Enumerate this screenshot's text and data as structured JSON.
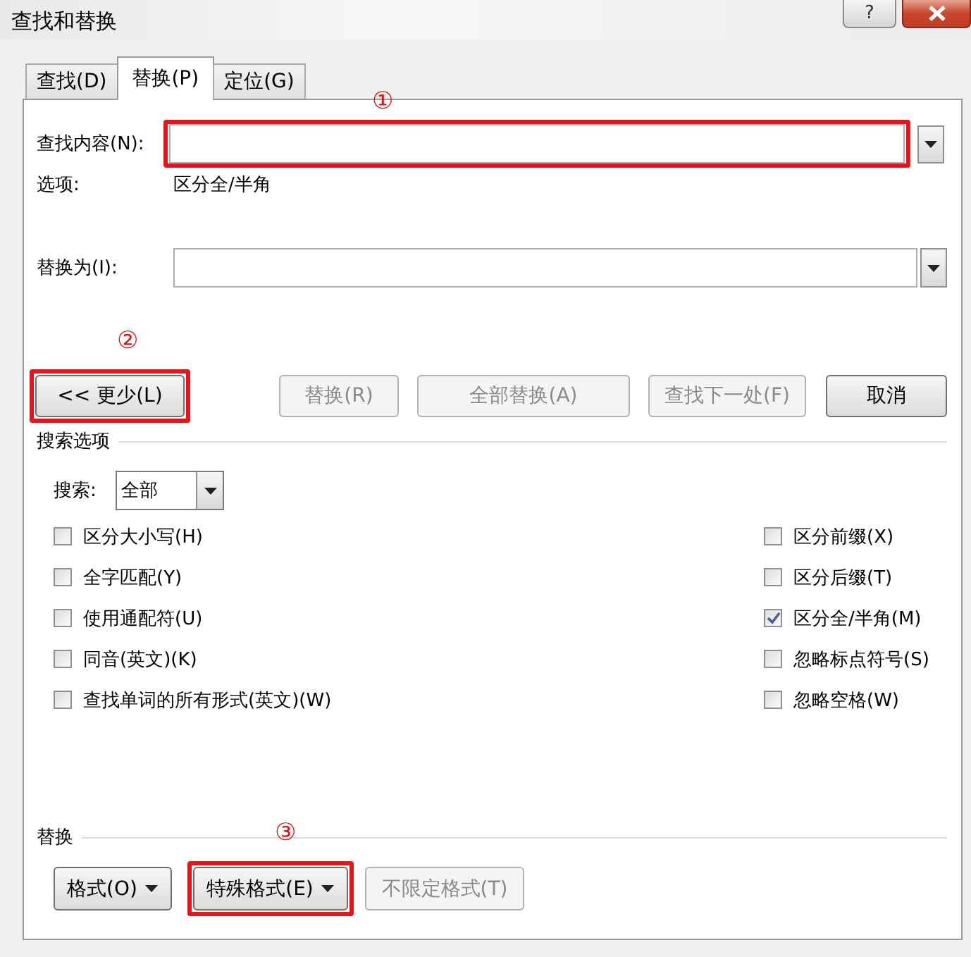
{
  "window": {
    "title": "查找和替换",
    "help_button": "?"
  },
  "tabs": [
    {
      "label": "查找(D)",
      "selected": false
    },
    {
      "label": "替换(P)",
      "selected": true
    },
    {
      "label": "定位(G)",
      "selected": false
    }
  ],
  "find": {
    "label": "查找内容(N):",
    "highlighted": true,
    "annotation": "①"
  },
  "options": {
    "label": "选项:",
    "value": "区分全/半角"
  },
  "replace": {
    "label": "替换为(I):"
  },
  "buttons": [
    {
      "label": "<< 更少(L)",
      "disabled": false,
      "highlighted": true,
      "annotation": "②"
    },
    {
      "label": "替换(R)",
      "disabled": true,
      "highlighted": false
    },
    {
      "label": "全部替换(A)",
      "disabled": true,
      "highlighted": false
    },
    {
      "label": "查找下一处(F)",
      "disabled": true,
      "highlighted": false
    },
    {
      "label": "取消",
      "disabled": false,
      "highlighted": false
    }
  ],
  "search_options": {
    "title": "搜索选项",
    "search_label": "搜索:",
    "search_value": "全部",
    "checkboxes_left": [
      {
        "label": "区分大小写(H)",
        "checked": false
      },
      {
        "label": "全字匹配(Y)",
        "checked": false
      },
      {
        "label": "使用通配符(U)",
        "checked": false
      },
      {
        "label": "同音(英文)(K)",
        "checked": false
      },
      {
        "label": "查找单词的所有形式(英文)(W)",
        "checked": false
      }
    ],
    "checkboxes_right": [
      {
        "label": "区分前缀(X)",
        "checked": false
      },
      {
        "label": "区分后缀(T)",
        "checked": false
      },
      {
        "label": "区分全/半角(M)",
        "checked": true
      },
      {
        "label": "忽略标点符号(S)",
        "checked": false
      },
      {
        "label": "忽略空格(W)",
        "checked": false
      }
    ]
  },
  "replace_section": {
    "title": "替换",
    "buttons": [
      {
        "label": "格式(O)",
        "dropdown": true,
        "disabled": false,
        "highlighted": false
      },
      {
        "label": "特殊格式(E)",
        "dropdown": true,
        "disabled": false,
        "highlighted": true,
        "annotation": "③"
      },
      {
        "label": "不限定格式(T)",
        "dropdown": false,
        "disabled": true,
        "highlighted": false
      }
    ]
  }
}
